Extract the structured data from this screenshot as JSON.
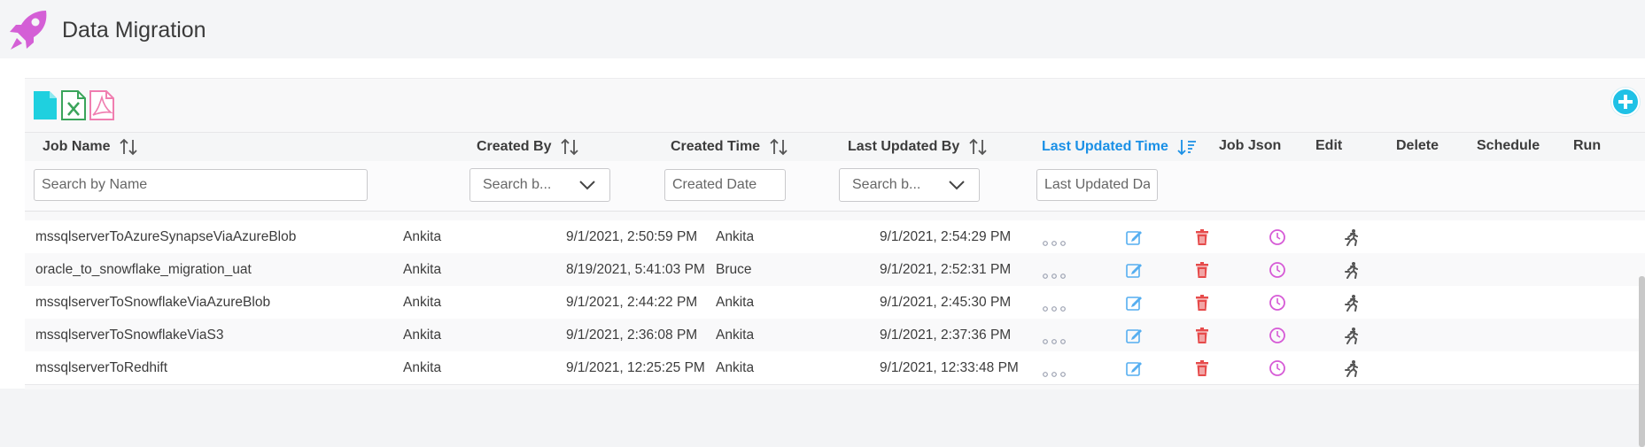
{
  "app": {
    "title": "Data Migration",
    "logo_icon": "rocket-icon",
    "accent_color": "#1a90e6",
    "logo_color": "#d45fd6"
  },
  "toolbar": {
    "export_icons": [
      "file-icon",
      "excel-icon",
      "pdf-icon"
    ],
    "add_icon": "plus-circle-icon"
  },
  "table": {
    "columns": {
      "job_name": "Job Name",
      "created_by": "Created By",
      "created_time": "Created Time",
      "last_updated_by": "Last Updated By",
      "last_updated_time": "Last Updated Time",
      "job_json": "Job Json",
      "edit": "Edit",
      "delete": "Delete",
      "schedule": "Schedule",
      "run": "Run"
    },
    "filters": {
      "name_placeholder": "Search by Name",
      "created_by_value": "Search b...",
      "created_date_placeholder": "Created Date",
      "last_updated_by_value": "Search b...",
      "last_updated_placeholder": "Last Updated Da"
    },
    "rows": [
      {
        "job_name": "mssqlserverToAzureSynapseViaAzureBlob",
        "created_by": "Ankita",
        "created_time": "9/1/2021, 2:50:59 PM",
        "last_updated_by": "Ankita",
        "last_updated_time": "9/1/2021, 2:54:29 PM"
      },
      {
        "job_name": "oracle_to_snowflake_migration_uat",
        "created_by": "Ankita",
        "created_time": "8/19/2021, 5:41:03 PM",
        "last_updated_by": "Bruce",
        "last_updated_time": "9/1/2021, 2:52:31 PM"
      },
      {
        "job_name": "mssqlserverToSnowflakeViaAzureBlob",
        "created_by": "Ankita",
        "created_time": "9/1/2021, 2:44:22 PM",
        "last_updated_by": "Ankita",
        "last_updated_time": "9/1/2021, 2:45:30 PM"
      },
      {
        "job_name": "mssqlserverToSnowflakeViaS3",
        "created_by": "Ankita",
        "created_time": "9/1/2021, 2:36:08 PM",
        "last_updated_by": "Ankita",
        "last_updated_time": "9/1/2021, 2:37:36 PM"
      },
      {
        "job_name": "mssqlserverToRedhift",
        "created_by": "Ankita",
        "created_time": "9/1/2021, 12:25:25 PM",
        "last_updated_by": "Ankita",
        "last_updated_time": "9/1/2021, 12:33:48 PM"
      }
    ],
    "row_icons": {
      "job_json": "more-dots-icon",
      "edit": "edit-icon",
      "delete": "trash-icon",
      "schedule": "clock-icon",
      "run": "run-icon"
    }
  }
}
